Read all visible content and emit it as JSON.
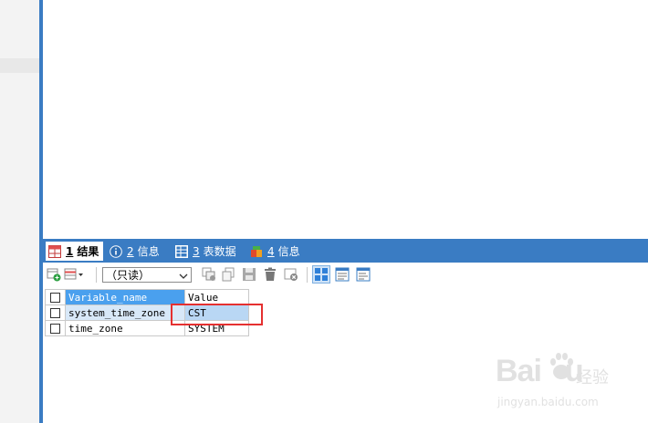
{
  "tabs": [
    {
      "num": "1",
      "label": "结果",
      "active": true
    },
    {
      "num": "2",
      "label": "信息",
      "active": false
    },
    {
      "num": "3",
      "label": "表数据",
      "active": false
    },
    {
      "num": "4",
      "label": "信息",
      "active": false
    }
  ],
  "toolbar": {
    "mode_value": "（只读）"
  },
  "grid": {
    "headers": [
      "Variable_name",
      "Value"
    ],
    "rows": [
      {
        "name": "system_time_zone",
        "value": "CST"
      },
      {
        "name": "time_zone",
        "value": "SYSTEM"
      }
    ]
  },
  "watermark": {
    "brand_a": "Bai",
    "brand_b": "u",
    "brand_cn": "经验",
    "url": "jingyan.baidu.com"
  },
  "colors": {
    "accent": "#3a7cc3",
    "header": "#4aa0ee",
    "highlight": "#e53030"
  }
}
